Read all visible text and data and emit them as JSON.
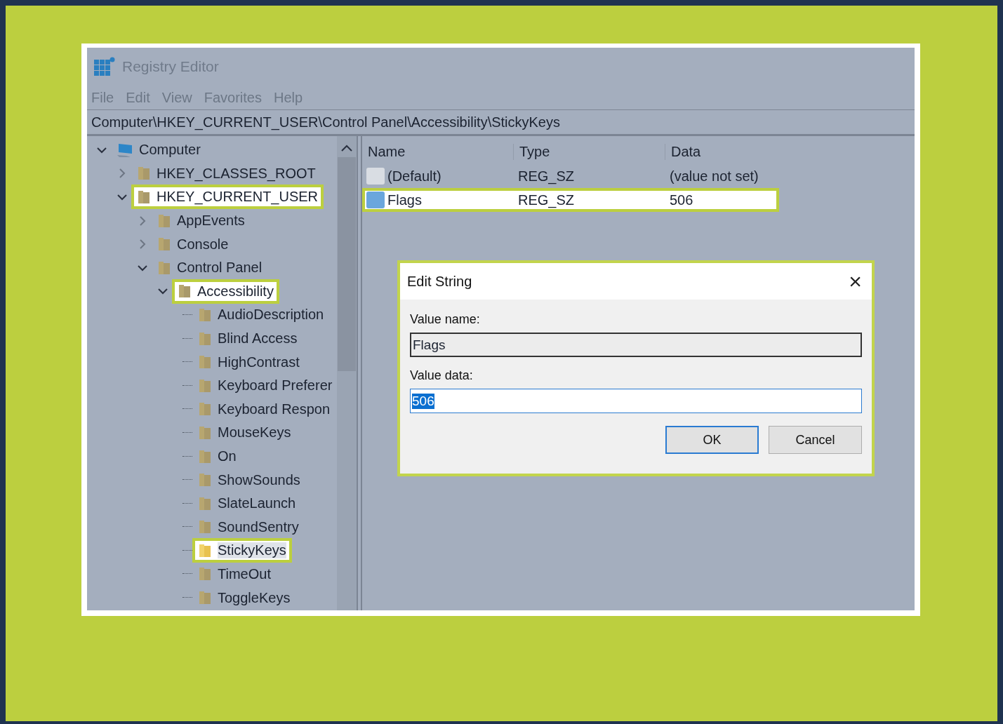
{
  "window": {
    "title": "Registry Editor"
  },
  "menu": [
    "File",
    "Edit",
    "View",
    "Favorites",
    "Help"
  ],
  "address": "Computer\\HKEY_CURRENT_USER\\Control Panel\\Accessibility\\StickyKeys",
  "tree": [
    {
      "label": "Computer",
      "kind": "computer",
      "expanded": true,
      "highlighted": false,
      "selected": false,
      "children": [
        {
          "label": "HKEY_CLASSES_ROOT",
          "kind": "folder",
          "expanded": false,
          "highlighted": false,
          "selected": false
        },
        {
          "label": "HKEY_CURRENT_USER",
          "kind": "folder",
          "expanded": true,
          "highlighted": true,
          "selected": false,
          "children": [
            {
              "label": "AppEvents",
              "kind": "folder",
              "expanded": false,
              "highlighted": false,
              "selected": false
            },
            {
              "label": "Console",
              "kind": "folder",
              "expanded": false,
              "highlighted": false,
              "selected": false
            },
            {
              "label": "Control Panel",
              "kind": "folder",
              "expanded": true,
              "highlighted": false,
              "selected": false,
              "children": [
                {
                  "label": "Accessibility",
                  "kind": "folder",
                  "expanded": true,
                  "highlighted": true,
                  "selected": false,
                  "children": [
                    {
                      "label": "AudioDescription",
                      "kind": "folder",
                      "highlighted": false,
                      "selected": false
                    },
                    {
                      "label": "Blind Access",
                      "kind": "folder",
                      "highlighted": false,
                      "selected": false
                    },
                    {
                      "label": "HighContrast",
                      "kind": "folder",
                      "highlighted": false,
                      "selected": false
                    },
                    {
                      "label": "Keyboard Preferer",
                      "kind": "folder",
                      "highlighted": false,
                      "selected": false
                    },
                    {
                      "label": "Keyboard Respon",
                      "kind": "folder",
                      "highlighted": false,
                      "selected": false
                    },
                    {
                      "label": "MouseKeys",
                      "kind": "folder",
                      "highlighted": false,
                      "selected": false
                    },
                    {
                      "label": "On",
                      "kind": "folder",
                      "highlighted": false,
                      "selected": false
                    },
                    {
                      "label": "ShowSounds",
                      "kind": "folder",
                      "highlighted": false,
                      "selected": false
                    },
                    {
                      "label": "SlateLaunch",
                      "kind": "folder",
                      "highlighted": false,
                      "selected": false
                    },
                    {
                      "label": "SoundSentry",
                      "kind": "folder",
                      "highlighted": false,
                      "selected": false
                    },
                    {
                      "label": "StickyKeys",
                      "kind": "folder",
                      "highlighted": true,
                      "selected": true
                    },
                    {
                      "label": "TimeOut",
                      "kind": "folder",
                      "highlighted": false,
                      "selected": false
                    },
                    {
                      "label": "ToggleKeys",
                      "kind": "folder",
                      "highlighted": false,
                      "selected": false
                    }
                  ]
                }
              ]
            }
          ]
        }
      ]
    }
  ],
  "values": {
    "columns": [
      "Name",
      "Type",
      "Data"
    ],
    "rows": [
      {
        "name": "(Default)",
        "type": "REG_SZ",
        "data": "(value not set)",
        "selected": false,
        "highlighted": false
      },
      {
        "name": "Flags",
        "type": "REG_SZ",
        "data": "506",
        "selected": true,
        "highlighted": true
      }
    ]
  },
  "dialog": {
    "title": "Edit String",
    "close": "×",
    "highlighted": true,
    "name_label": "Value name:",
    "name_value": "Flags",
    "data_label": "Value data:",
    "data_value": "506",
    "data_selected": true,
    "buttons": [
      {
        "label": "OK",
        "default": true
      },
      {
        "label": "Cancel",
        "default": false
      }
    ]
  }
}
